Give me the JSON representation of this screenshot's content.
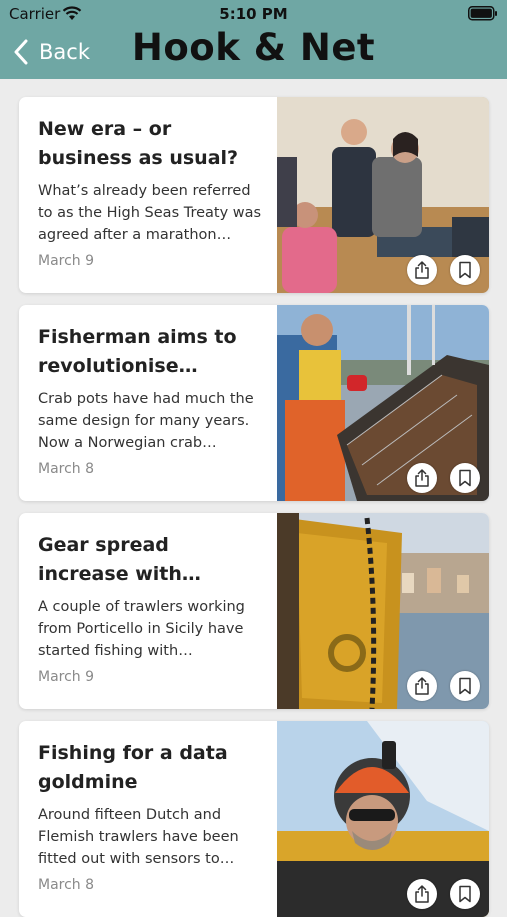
{
  "status_bar": {
    "carrier": "Carrier",
    "time": "5:10 PM"
  },
  "nav": {
    "back_label": "Back",
    "title": "Hook & Net"
  },
  "colors": {
    "header": "#6fa7a4",
    "background": "#ececec"
  },
  "articles": [
    {
      "title": "New era – or business as usual?",
      "summary": "What’s already been referred to as the High Seas Treaty was agreed after a marathon sessio…",
      "date": "March 9",
      "image": "conference-applause-photo"
    },
    {
      "title": "Fisherman aims to revolutionise crabbing",
      "summary": "Crab pots have had much the same design for many years. Now a Norwegian crab fisherman is…",
      "date": "March 8",
      "image": "fisherman-crab-pot-photo"
    },
    {
      "title": "Gear spread increase with modern trawl…",
      "summary": "A couple of trawlers working from Porticello in Sicily have started fishing with upgraded…",
      "date": "March 9",
      "image": "trawl-door-harbour-photo"
    },
    {
      "title": "Fishing for a data goldmine",
      "summary": "Around fifteen Dutch and Flemish trawlers have been fitted out with sensors to collect data at…",
      "date": "March 8",
      "image": "fisherman-helmet-camera-photo"
    }
  ]
}
